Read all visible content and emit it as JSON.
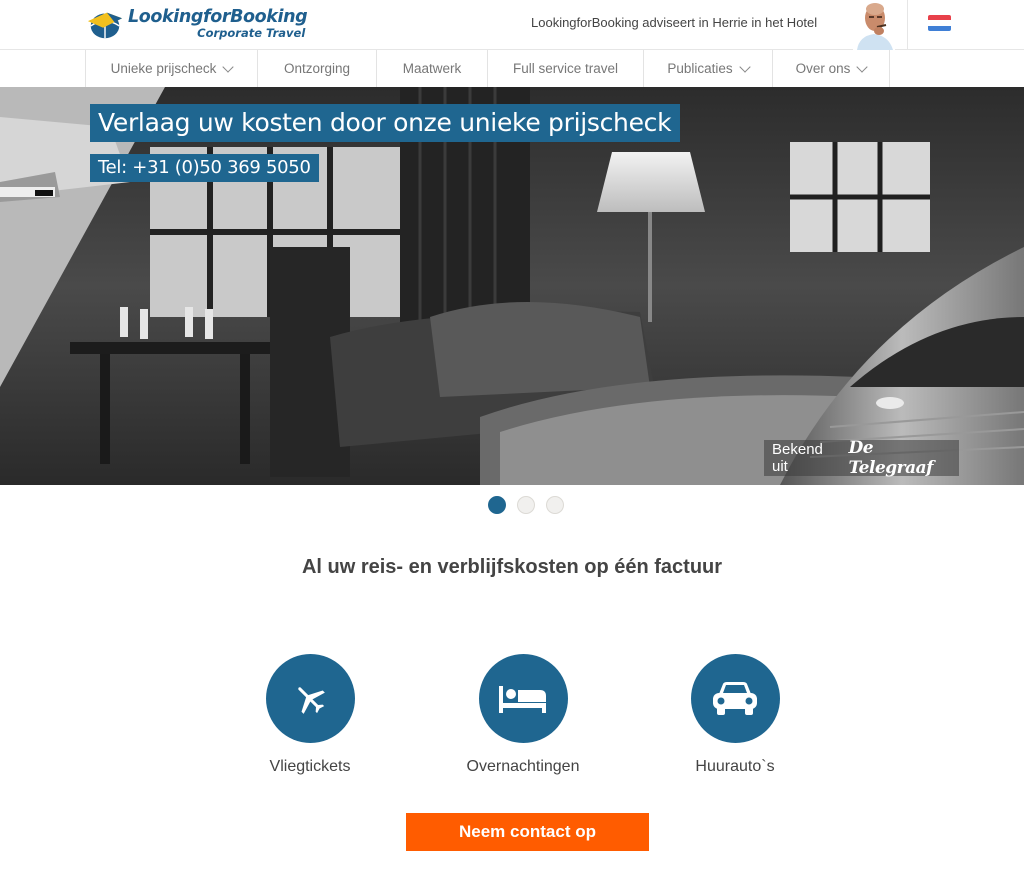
{
  "header": {
    "logo": {
      "title": "LookingforBooking",
      "subtitle": "Corporate Travel"
    },
    "tv_link": "LookingforBooking adviseert in Herrie in het Hotel",
    "avatar_icon": "person-photo",
    "language_flag": {
      "name": "netherlands-flag",
      "colors": [
        "#e8404a",
        "#ffffff",
        "#3f7fd6"
      ]
    }
  },
  "nav": {
    "items": [
      {
        "label": "Unieke prijscheck",
        "has_dropdown": true
      },
      {
        "label": "Ontzorging",
        "has_dropdown": false
      },
      {
        "label": "Maatwerk",
        "has_dropdown": false
      },
      {
        "label": "Full service travel",
        "has_dropdown": false
      },
      {
        "label": "Publicaties",
        "has_dropdown": true
      },
      {
        "label": "Over ons",
        "has_dropdown": true
      }
    ]
  },
  "hero": {
    "title": "Verlaag uw kosten door onze unieke prijscheck",
    "phone": "Tel: +31 (0)50 369 5050",
    "press_label": "Bekend uit",
    "press_logo": "De Telegraaf"
  },
  "carousel": {
    "slides": 3,
    "active_index": 0
  },
  "tagline": "Al uw reis- en verblijfskosten op één factuur",
  "services": [
    {
      "label": "Vliegtickets",
      "icon": "plane-icon"
    },
    {
      "label": "Overnachtingen",
      "icon": "bed-icon"
    },
    {
      "label": "Huurauto`s",
      "icon": "car-icon"
    }
  ],
  "cta": {
    "label": "Neem contact op"
  },
  "colors": {
    "brand_blue": "#1f6690",
    "cta_orange": "#ff5c00",
    "logo_yellow": "#f2c01e"
  }
}
